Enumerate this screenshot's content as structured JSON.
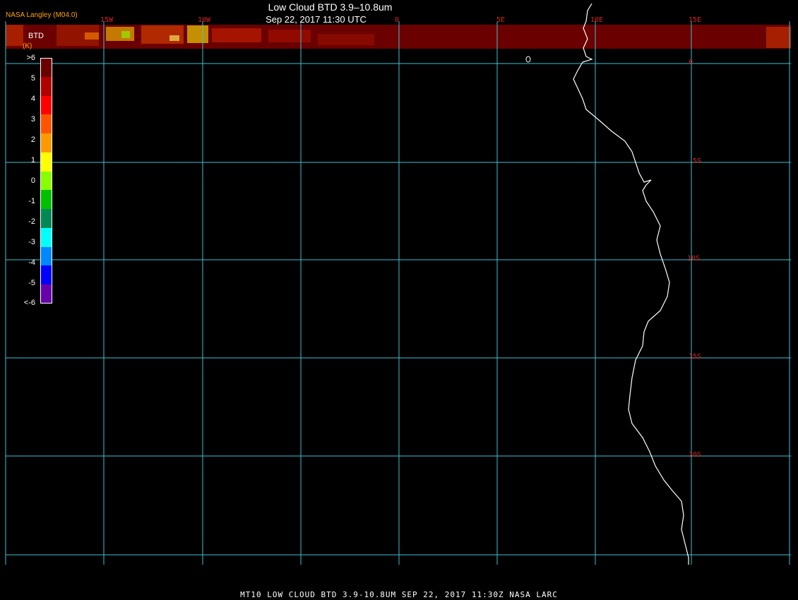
{
  "header": {
    "title": "Low Cloud BTD 3.9–10.8um",
    "subtitle": "Sep 22, 2017 11:30 UTC",
    "org": "NASA Langley (M04.0)"
  },
  "colorbar": {
    "title": "BTD",
    "unit": "(K)",
    "labels": [
      ">6",
      "5",
      "4",
      "3",
      "2",
      "1",
      "0",
      "-1",
      "-2",
      "-3",
      "-4",
      "-5",
      "<-6"
    ],
    "colors": [
      "#6b0000",
      "#b00000",
      "#ff0000",
      "#ff5500",
      "#ff9900",
      "#ffff00",
      "#88ff00",
      "#00c000",
      "#008855",
      "#00ffff",
      "#0088ff",
      "#0000ff",
      "#6600aa"
    ]
  },
  "map": {
    "longitude_labels": [
      "15W",
      "10W",
      "0",
      "5E",
      "10E",
      "15E"
    ],
    "latitude_labels": [
      "0",
      "5S",
      "10S",
      "15S",
      "20S"
    ],
    "grid_color": "#40c0d0",
    "coast_color": "#ffffff",
    "cloud_color": "#6b0000"
  },
  "footer": {
    "text": "MT10  LOW CLOUD BTD 3.9-10.8UM   SEP 22, 2017 11:30Z  NASA LARC"
  }
}
